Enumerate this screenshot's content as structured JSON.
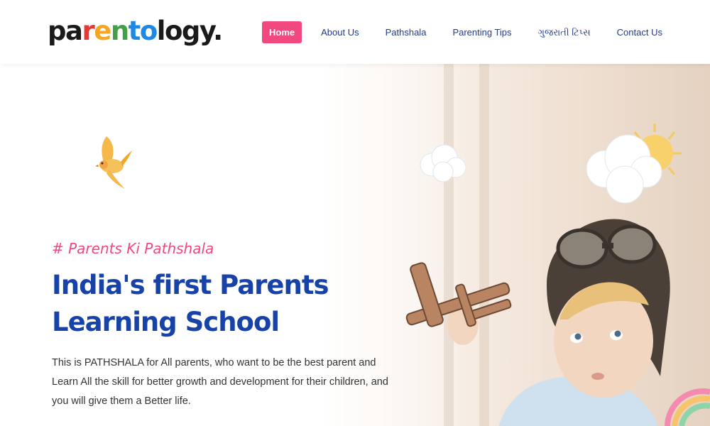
{
  "header": {
    "logo": {
      "parts": [
        "pa",
        "r",
        "e",
        "n",
        "to",
        "logy."
      ]
    },
    "nav": [
      {
        "label": "Home",
        "active": true
      },
      {
        "label": "About Us",
        "active": false
      },
      {
        "label": "Pathshala",
        "active": false
      },
      {
        "label": "Parenting Tips",
        "active": false
      },
      {
        "label": "ગુજરાતી ટિપ્સ",
        "active": false
      },
      {
        "label": "Contact Us",
        "active": false
      }
    ]
  },
  "hero": {
    "hashtag": "# Parents Ki Pathshala",
    "headline_line1": "India's first Parents",
    "headline_line2": "Learning School",
    "description": "This is PATHSHALA for All parents, who want to be the best parent and Learn All the skill for better growth and development for their children, and you will give them a Better life."
  },
  "colors": {
    "accent_pink": "#f0487f",
    "headline_blue": "#1743a8",
    "nav_blue": "#1f3a93"
  },
  "icons": [
    "bird-illustration",
    "cloud-illustration",
    "sun-illustration",
    "child-aviator-illustration",
    "rainbow-illustration"
  ]
}
